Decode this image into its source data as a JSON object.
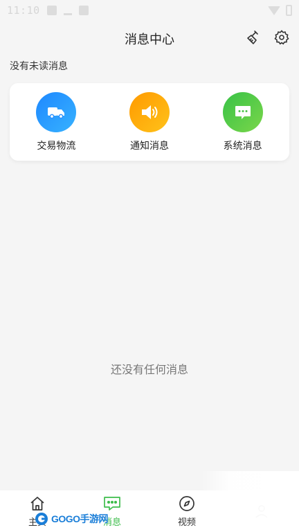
{
  "status_bar": {
    "time": "11:10"
  },
  "header": {
    "title": "消息中心"
  },
  "unread_text": "没有未读消息",
  "categories": [
    {
      "label": "交易物流",
      "icon": "truck-icon",
      "color_from": "#1e88ff",
      "color_to": "#37b2ff"
    },
    {
      "label": "通知消息",
      "icon": "speaker-icon",
      "color_from": "#ff9a00",
      "color_to": "#ffc21a"
    },
    {
      "label": "系统消息",
      "icon": "chat-bubble-icon",
      "color_from": "#38c247",
      "color_to": "#7ad64a"
    }
  ],
  "empty_text": "还没有任何消息",
  "tabbar": {
    "items": [
      {
        "label": "主页",
        "icon": "home-icon"
      },
      {
        "label": "消息",
        "icon": "message-icon",
        "active": true
      },
      {
        "label": "视频",
        "icon": "compass-icon"
      }
    ],
    "active_color": "#3dbd4b"
  },
  "watermark": {
    "text": "GOGO手游网"
  }
}
